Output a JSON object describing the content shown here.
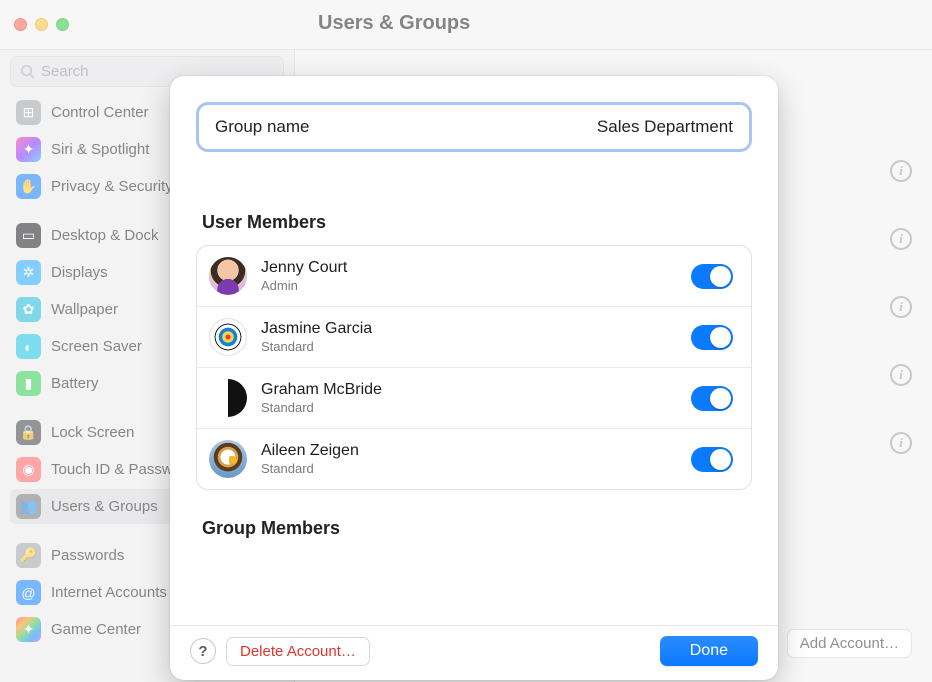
{
  "window": {
    "title": "Users & Groups"
  },
  "sidebar": {
    "search_placeholder": "Search",
    "items": [
      {
        "label": "Control Center",
        "icon_bg": "#9aa0a6",
        "glyph": "⊞"
      },
      {
        "label": "Siri & Spotlight",
        "icon_bg": "linear-gradient(135deg,#ff2d9b,#7a2dff,#2da8ff)",
        "glyph": "✦"
      },
      {
        "label": "Privacy & Security",
        "icon_bg": "#0a7aff",
        "glyph": "✋"
      },
      {
        "gap": true
      },
      {
        "label": "Desktop & Dock",
        "icon_bg": "#1d1d1f",
        "glyph": "▭"
      },
      {
        "label": "Displays",
        "icon_bg": "#1fa7ff",
        "glyph": "✲"
      },
      {
        "label": "Wallpaper",
        "icon_bg": "#17b7d8",
        "glyph": "✿"
      },
      {
        "label": "Screen Saver",
        "icon_bg": "#12c1e0",
        "glyph": "◐"
      },
      {
        "label": "Battery",
        "icon_bg": "#2fcc4d",
        "glyph": "▮"
      },
      {
        "gap": true
      },
      {
        "label": "Lock Screen",
        "icon_bg": "#3c3c40",
        "glyph": "🔒"
      },
      {
        "label": "Touch ID & Password",
        "icon_bg": "#ff5d5d",
        "glyph": "◉"
      },
      {
        "label": "Users & Groups",
        "icon_bg": "#6f7278",
        "glyph": "👥",
        "active": true
      },
      {
        "gap": true
      },
      {
        "label": "Passwords",
        "icon_bg": "#9aa0a6",
        "glyph": "🔑"
      },
      {
        "label": "Internet Accounts",
        "icon_bg": "#0a7aff",
        "glyph": "@"
      },
      {
        "label": "Game Center",
        "icon_bg": "linear-gradient(135deg,#ff2d55,#ff9500,#34c759,#0a84ff,#af52de)",
        "glyph": "✦"
      }
    ]
  },
  "background_content": {
    "info_button_count": 5,
    "add_account_label": "Add Account…"
  },
  "modal": {
    "group_name_label": "Group name",
    "group_name_value": "Sales Department",
    "user_members_title": "User Members",
    "group_members_title": "Group Members",
    "users": [
      {
        "name": "Jenny Court",
        "role": "Admin",
        "enabled": true,
        "avatar_class": "av1"
      },
      {
        "name": "Jasmine Garcia",
        "role": "Standard",
        "enabled": true,
        "avatar_class": "av2"
      },
      {
        "name": "Graham McBride",
        "role": "Standard",
        "enabled": true,
        "avatar_class": "av3"
      },
      {
        "name": "Aileen Zeigen",
        "role": "Standard",
        "enabled": true,
        "avatar_class": "av4"
      }
    ],
    "help_label": "?",
    "delete_label": "Delete Account…",
    "done_label": "Done"
  }
}
